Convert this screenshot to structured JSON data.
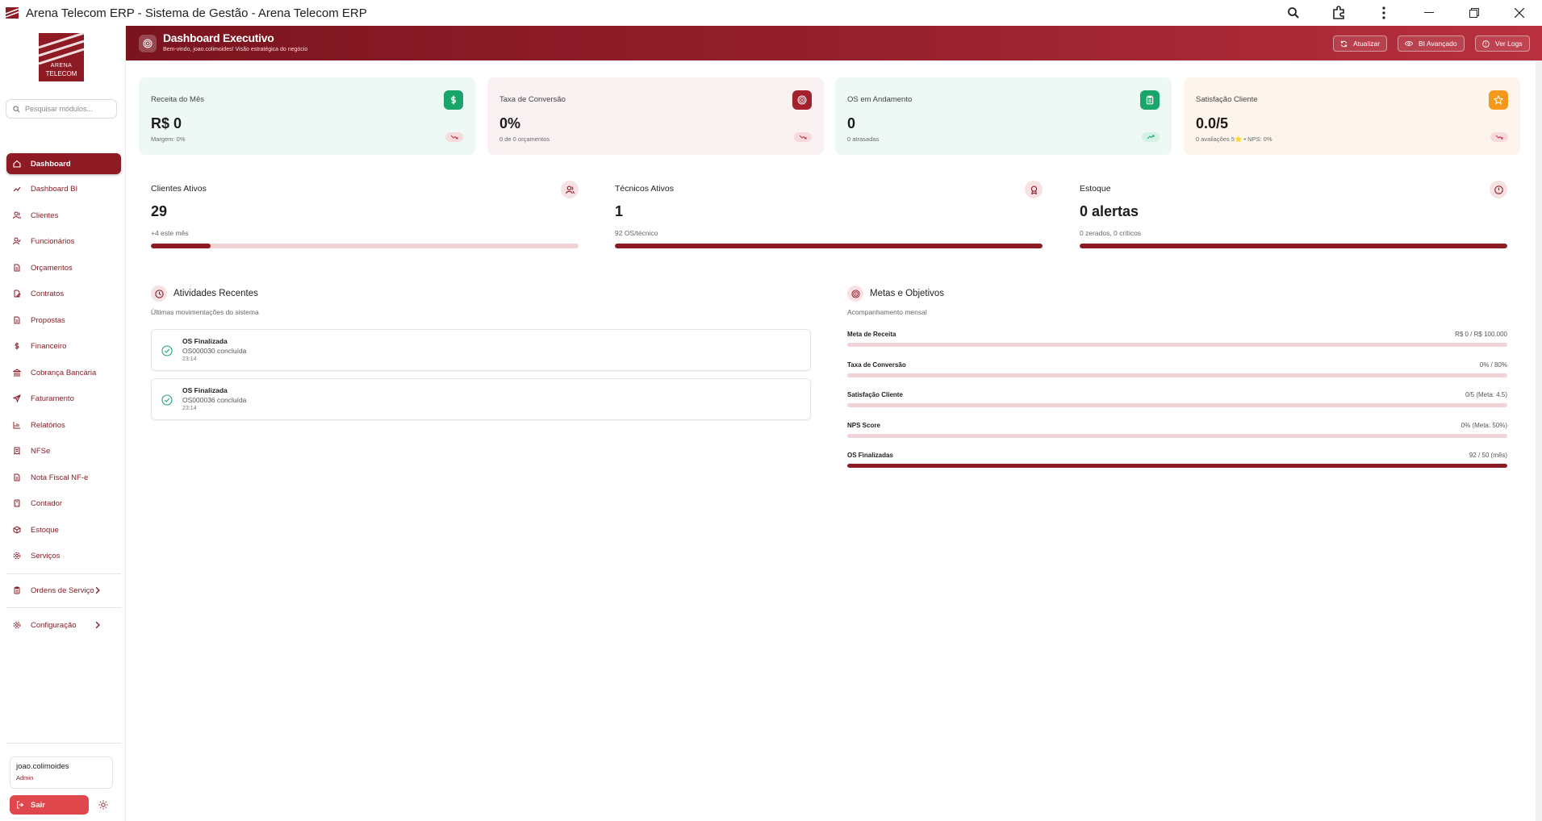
{
  "window": {
    "title": "Arena Telecom ERP - Sistema de Gestão - Arena Telecom ERP"
  },
  "sidebar": {
    "logo_line1": "ARENA",
    "logo_line2": "TELECOM",
    "search_placeholder": "Pesquisar módulos...",
    "items": [
      {
        "label": "Dashboard",
        "icon": "home-icon",
        "active": true
      },
      {
        "label": "Dashboard BI",
        "icon": "trending-up-icon"
      },
      {
        "label": "Clientes",
        "icon": "users-icon"
      },
      {
        "label": "Funcionários",
        "icon": "user-check-icon"
      },
      {
        "label": "Orçamentos",
        "icon": "file-text-icon"
      },
      {
        "label": "Contratos",
        "icon": "file-signature-icon"
      },
      {
        "label": "Propostas",
        "icon": "file-icon"
      },
      {
        "label": "Financeiro",
        "icon": "dollar-icon"
      },
      {
        "label": "Cobrança Bancária",
        "icon": "bank-icon"
      },
      {
        "label": "Faturamento",
        "icon": "send-icon"
      },
      {
        "label": "Relatórios",
        "icon": "bar-chart-icon"
      },
      {
        "label": "NFSe",
        "icon": "receipt-icon"
      },
      {
        "label": "Nota Fiscal NF-e",
        "icon": "invoice-icon"
      },
      {
        "label": "Contador",
        "icon": "calculator-icon"
      },
      {
        "label": "Estoque",
        "icon": "package-icon"
      },
      {
        "label": "Serviços",
        "icon": "settings-icon"
      }
    ],
    "groups": [
      {
        "label": "Ordens de Serviço",
        "icon": "clipboard-icon"
      },
      {
        "label": "Configuração",
        "icon": "gear-icon"
      }
    ],
    "user": {
      "name": "joao.colimoides",
      "role": "Admin"
    },
    "logout_label": "Sair"
  },
  "header": {
    "title": "Dashboard Executivo",
    "subtitle": "Bem-vindo, joao.colimoides! Visão estratégica do negócio",
    "buttons": {
      "refresh": "Atualizar",
      "bi": "BI Avançado",
      "logs": "Ver Logs"
    }
  },
  "kpis": [
    {
      "label": "Receita do Mês",
      "value": "R$ 0",
      "sub": "Margem: 0%",
      "icon": "dollar-icon",
      "icon_color": "#1aa56b",
      "bg": "#eef8f4",
      "trend": "down"
    },
    {
      "label": "Taxa de Conversão",
      "value": "0%",
      "sub": "0 de 0 orçamentos",
      "icon": "target-icon",
      "icon_color": "#a3202c",
      "bg": "#f9f1f2",
      "trend": "down"
    },
    {
      "label": "OS em Andamento",
      "value": "0",
      "sub": "0 atrasadas",
      "icon": "clipboard-icon",
      "icon_color": "#1aa56b",
      "bg": "#eef8f4",
      "trend": "up"
    },
    {
      "label": "Satisfação Cliente",
      "value": "0.0/5",
      "sub": "0 avaliações 5⭐ • NPS: 0%",
      "icon": "star-icon",
      "icon_color": "#f39a1d",
      "bg": "#fdf4ec",
      "trend": "down"
    }
  ],
  "stats": [
    {
      "label": "Clientes Ativos",
      "value": "29",
      "sub": "+4 este mês",
      "icon": "users-icon",
      "progress": 0.14
    },
    {
      "label": "Técnicos Ativos",
      "value": "1",
      "sub": "92 OS/técnico",
      "icon": "award-icon",
      "progress": 1.0
    },
    {
      "label": "Estoque",
      "value": "0 alertas",
      "sub": "0 zerados, 0 críticos",
      "icon": "alert-circle-icon",
      "progress": 1.0
    }
  ],
  "activities": {
    "title": "Atividades Recentes",
    "subtitle": "Últimas movimentações do sistema",
    "items": [
      {
        "title": "OS Finalizada",
        "desc": "OS000030 concluída",
        "time": "23:14"
      },
      {
        "title": "OS Finalizada",
        "desc": "OS000036 concluída",
        "time": "23:14"
      }
    ]
  },
  "goals": {
    "title": "Metas e Objetivos",
    "subtitle": "Acompanhamento mensal",
    "items": [
      {
        "label": "Meta de Receita",
        "value": "R$ 0 / R$ 100.000",
        "progress": 0
      },
      {
        "label": "Taxa de Conversão",
        "value": "0% / 80%",
        "progress": 0
      },
      {
        "label": "Satisfação Cliente",
        "value": "0/5 (Meta: 4.5)",
        "progress": 0
      },
      {
        "label": "NPS Score",
        "value": "0% (Meta: 50%)",
        "progress": 0
      },
      {
        "label": "OS Finalizadas",
        "value": "92 / 50 (mês)",
        "progress": 1.0
      }
    ]
  },
  "colors": {
    "brand": "#8e1a24",
    "brand_light": "#efd3d6",
    "success": "#1aa56b",
    "logout": "#e0474c"
  }
}
